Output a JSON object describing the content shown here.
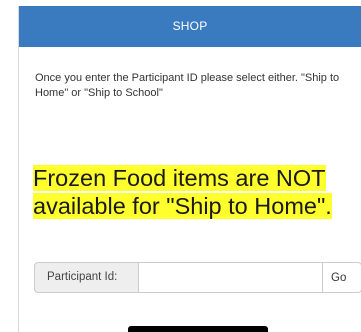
{
  "header": {
    "title": "SHOP"
  },
  "instructions": {
    "text": "Once you enter the Participant ID please select either. \"Ship to Home\" or \"Ship to School\""
  },
  "notice": {
    "text": "Frozen Food items are NOT available for \"Ship to Home\"."
  },
  "participant_form": {
    "label": "Participant Id:",
    "value": "",
    "placeholder": "",
    "go_label": "Go"
  },
  "colors": {
    "header_bg": "#3a7bbf",
    "highlight": "#ffff2e"
  }
}
